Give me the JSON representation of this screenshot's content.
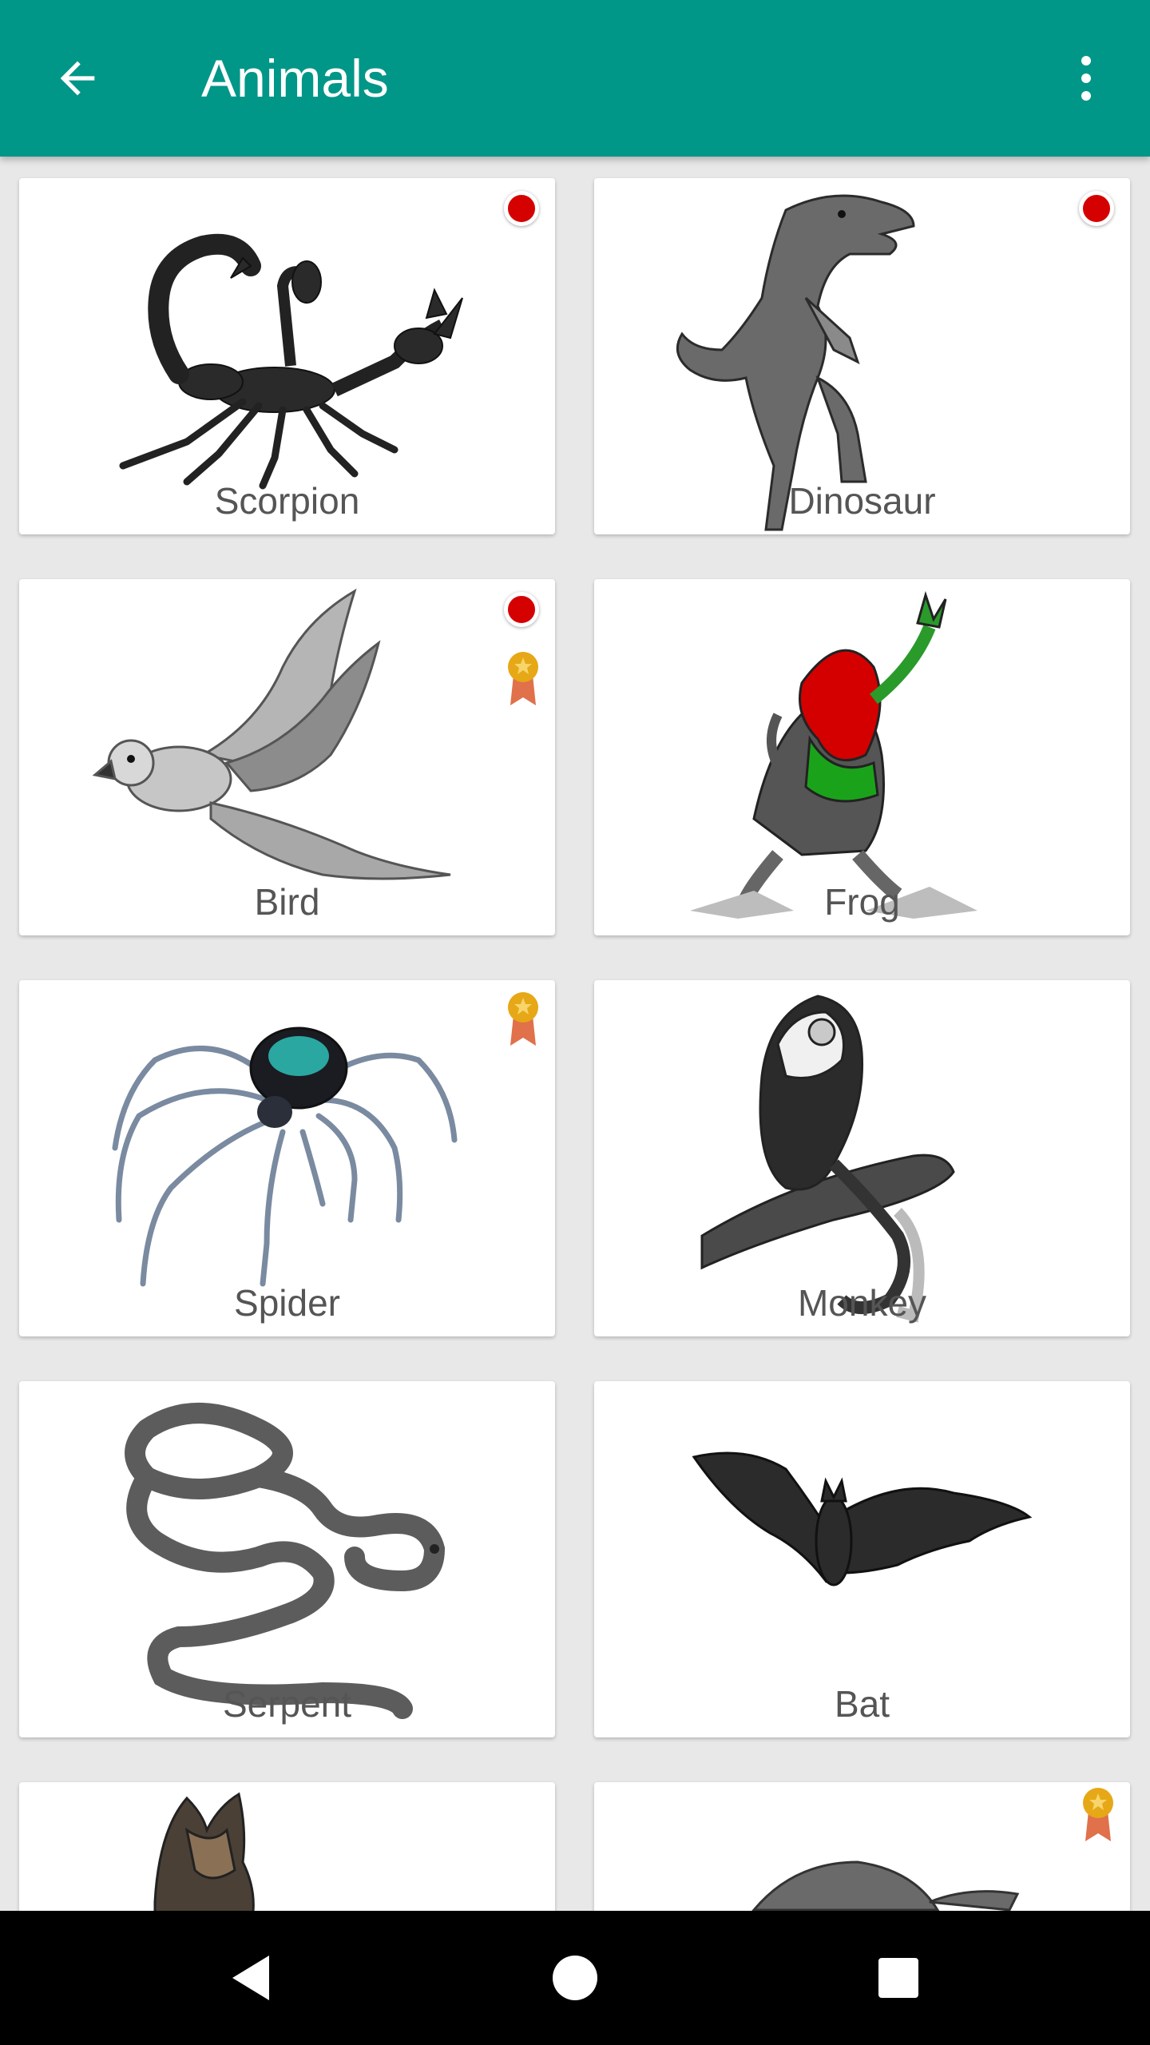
{
  "appbar": {
    "title": "Animals",
    "back_icon": "arrow-left-icon",
    "menu_icon": "more-vert-icon",
    "background": "#009688"
  },
  "cards": [
    {
      "name": "Scorpion",
      "red_dot": true,
      "medal": false
    },
    {
      "name": "Dinosaur",
      "red_dot": true,
      "medal": false
    },
    {
      "name": "Bird",
      "red_dot": true,
      "medal": true
    },
    {
      "name": "Frog",
      "red_dot": false,
      "medal": false
    },
    {
      "name": "Spider",
      "red_dot": false,
      "medal": true
    },
    {
      "name": "Monkey",
      "red_dot": false,
      "medal": false
    },
    {
      "name": "Serpent",
      "red_dot": false,
      "medal": false
    },
    {
      "name": "Bat",
      "red_dot": false,
      "medal": false
    },
    {
      "name": "",
      "red_dot": false,
      "medal": false
    },
    {
      "name": "",
      "red_dot": false,
      "medal": true
    }
  ],
  "colors": {
    "red_dot": "#d50000",
    "medal_gold": "#e6a817",
    "ribbon": "#e0714a"
  },
  "navbar": {
    "back_icon": "triangle-back-icon",
    "home_icon": "circle-home-icon",
    "recents_icon": "square-recents-icon"
  }
}
